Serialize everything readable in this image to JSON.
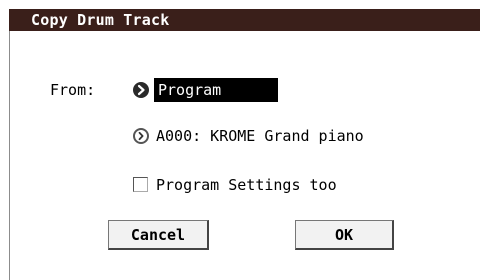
{
  "dialog": {
    "title": "Copy Drum Track",
    "from_label": "From:",
    "source": {
      "value": "Program",
      "icon": "circle-arrow-right-icon"
    },
    "program": {
      "value": "A000: KROME Grand piano",
      "icon": "circle-arrow-right-icon"
    },
    "program_settings": {
      "label": "Program Settings too",
      "checked": false
    },
    "buttons": {
      "cancel": "Cancel",
      "ok": "OK"
    }
  },
  "colors": {
    "title_bar": "#3a1f1a",
    "selected_field": "#000000"
  }
}
